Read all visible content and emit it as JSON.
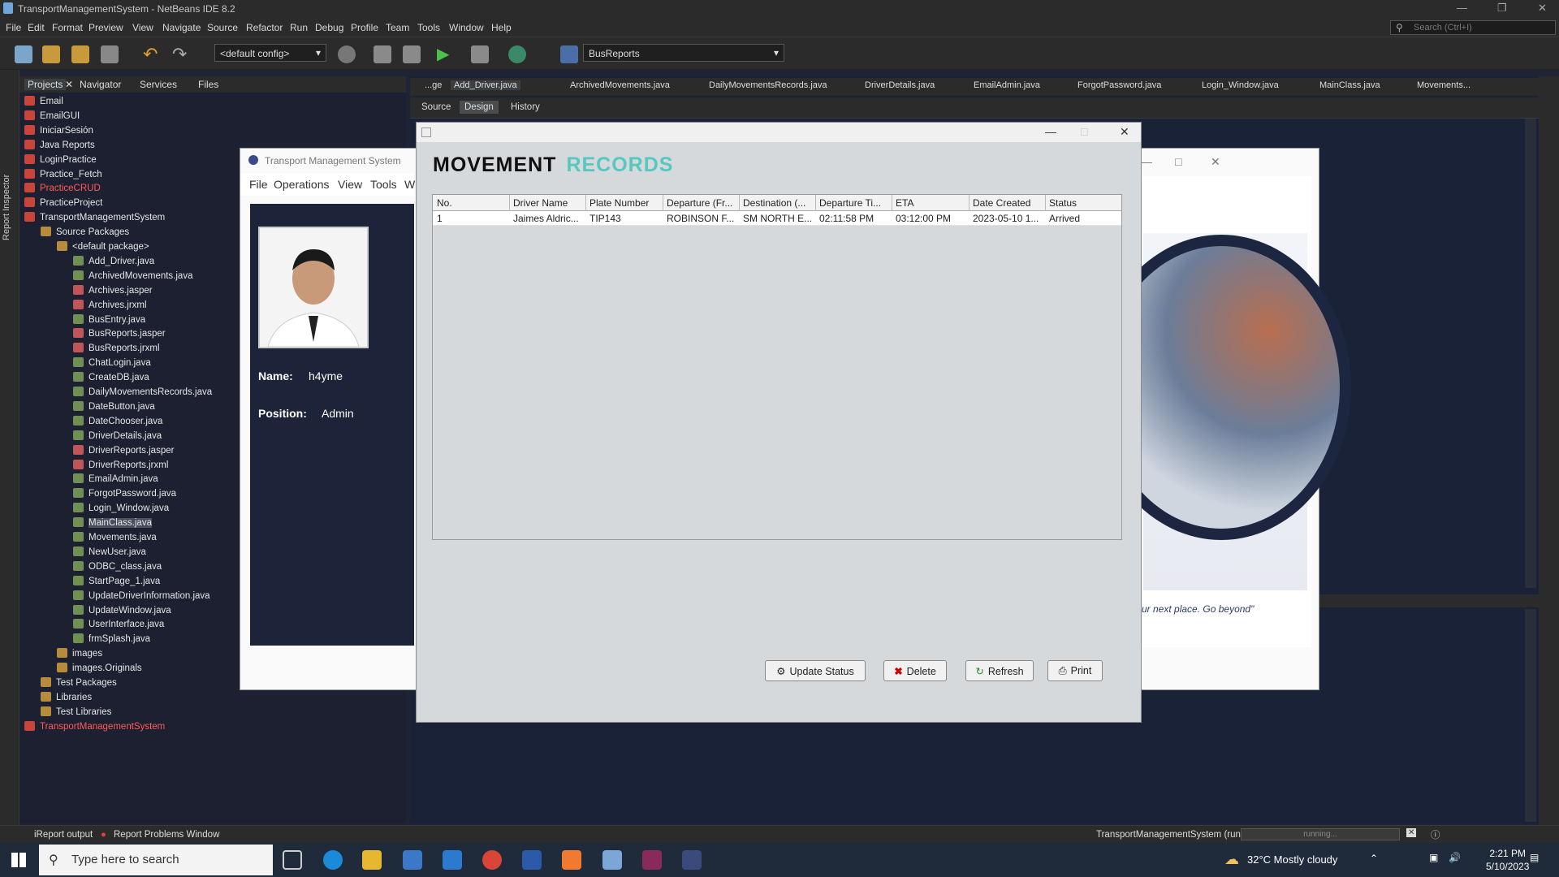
{
  "window": {
    "title": "TransportManagementSystem - NetBeans IDE 8.2"
  },
  "menubar": [
    "File",
    "Edit",
    "Format",
    "Preview",
    "View",
    "Navigate",
    "Source",
    "Refactor",
    "Run",
    "Debug",
    "Profile",
    "Team",
    "Tools",
    "Window",
    "Help"
  ],
  "search": {
    "placeholder": "Search (Ctrl+I)"
  },
  "toolbar": {
    "config": "<default config>",
    "target": "BusReports"
  },
  "left_strip": {
    "label": "Report Inspector"
  },
  "project_tabs": [
    "Projects",
    "Navigator",
    "Services",
    "Files"
  ],
  "tree": [
    {
      "label": "Email",
      "type": "proj",
      "level": 0
    },
    {
      "label": "EmailGUI",
      "type": "proj",
      "level": 0
    },
    {
      "label": "IniciarSesión",
      "type": "proj",
      "level": 0
    },
    {
      "label": "Java Reports",
      "type": "proj",
      "level": 0
    },
    {
      "label": "LoginPractice",
      "type": "proj",
      "level": 0
    },
    {
      "label": "Practice_Fetch",
      "type": "proj",
      "level": 0
    },
    {
      "label": "PracticeCRUD",
      "type": "proj",
      "level": 0,
      "red": true
    },
    {
      "label": "PracticeProject",
      "type": "proj",
      "level": 0
    },
    {
      "label": "TransportManagementSystem",
      "type": "proj",
      "level": 0
    },
    {
      "label": "Source Packages",
      "type": "pkg",
      "level": 1
    },
    {
      "label": "<default package>",
      "type": "pkg",
      "level": 2
    },
    {
      "label": "Add_Driver.java",
      "type": "java",
      "level": 3
    },
    {
      "label": "ArchivedMovements.java",
      "type": "java",
      "level": 3
    },
    {
      "label": "Archives.jasper",
      "type": "jasper",
      "level": 3
    },
    {
      "label": "Archives.jrxml",
      "type": "jasper",
      "level": 3
    },
    {
      "label": "BusEntry.java",
      "type": "java",
      "level": 3
    },
    {
      "label": "BusReports.jasper",
      "type": "jasper",
      "level": 3
    },
    {
      "label": "BusReports.jrxml",
      "type": "jasper",
      "level": 3
    },
    {
      "label": "ChatLogin.java",
      "type": "java",
      "level": 3
    },
    {
      "label": "CreateDB.java",
      "type": "java",
      "level": 3
    },
    {
      "label": "DailyMovementsRecords.java",
      "type": "java",
      "level": 3
    },
    {
      "label": "DateButton.java",
      "type": "java",
      "level": 3
    },
    {
      "label": "DateChooser.java",
      "type": "java",
      "level": 3
    },
    {
      "label": "DriverDetails.java",
      "type": "java",
      "level": 3
    },
    {
      "label": "DriverReports.jasper",
      "type": "jasper",
      "level": 3
    },
    {
      "label": "DriverReports.jrxml",
      "type": "jasper",
      "level": 3
    },
    {
      "label": "EmailAdmin.java",
      "type": "java",
      "level": 3
    },
    {
      "label": "ForgotPassword.java",
      "type": "java",
      "level": 3
    },
    {
      "label": "Login_Window.java",
      "type": "java",
      "level": 3
    },
    {
      "label": "MainClass.java",
      "type": "java",
      "level": 3,
      "selected": true
    },
    {
      "label": "Movements.java",
      "type": "java",
      "level": 3
    },
    {
      "label": "NewUser.java",
      "type": "java",
      "level": 3
    },
    {
      "label": "ODBC_class.java",
      "type": "java",
      "level": 3
    },
    {
      "label": "StartPage_1.java",
      "type": "java",
      "level": 3
    },
    {
      "label": "UpdateDriverInformation.java",
      "type": "java",
      "level": 3
    },
    {
      "label": "UpdateWindow.java",
      "type": "java",
      "level": 3
    },
    {
      "label": "UserInterface.java",
      "type": "java",
      "level": 3
    },
    {
      "label": "frmSplash.java",
      "type": "java",
      "level": 3
    },
    {
      "label": "images",
      "type": "pkg",
      "level": 2
    },
    {
      "label": "images.Originals",
      "type": "pkg",
      "level": 2
    },
    {
      "label": "Test Packages",
      "type": "pkg",
      "level": 1
    },
    {
      "label": "Libraries",
      "type": "pkg",
      "level": 1
    },
    {
      "label": "Test Libraries",
      "type": "pkg",
      "level": 1
    },
    {
      "label": "TransportManagementSystem",
      "type": "proj",
      "level": 0,
      "red": true
    }
  ],
  "editor_tabs": [
    "...ge",
    "Add_Driver.java",
    "ArchivedMovements.java",
    "DailyMovementsRecords.java",
    "DriverDetails.java",
    "EmailAdmin.java",
    "ForgotPassword.java",
    "Login_Window.java",
    "MainClass.java",
    "Movements..."
  ],
  "editor_toolbar": [
    "Source",
    "Design",
    "History"
  ],
  "bg_app": {
    "title": "Transport Management System",
    "menu": [
      "File",
      "Operations",
      "View",
      "Tools",
      "W"
    ],
    "name_label": "Name:",
    "name_value": "h4yme",
    "position_label": "Position:",
    "position_value": "Admin",
    "quote": "ur next place. Go beyond\""
  },
  "dialog": {
    "heading_1": "MOVEMENT",
    "heading_2": "RECORDS",
    "columns": [
      "No.",
      "Driver Name",
      "Plate Number",
      "Departure (Fr...",
      "Destination (...",
      "Departure Ti...",
      "ETA",
      "Date Created",
      "Status"
    ],
    "rows": [
      [
        "1",
        "Jaimes Aldric...",
        "TIP143",
        "ROBINSON F...",
        "SM NORTH E...",
        "02:11:58 PM",
        "03:12:00 PM",
        "2023-05-10 1...",
        "Arrived"
      ]
    ],
    "buttons": {
      "update": "Update Status",
      "delete": "Delete",
      "refresh": "Refresh",
      "print": "Print"
    }
  },
  "statusbar": {
    "ireport": "iReport output",
    "problems": "Report Problems Window",
    "run": "TransportManagementSystem (run)",
    "progress": "running..."
  },
  "taskbar": {
    "search": "Type here to search",
    "weather": "32°C  Mostly cloudy",
    "time": "2:21 PM",
    "date": "5/10/2023"
  }
}
